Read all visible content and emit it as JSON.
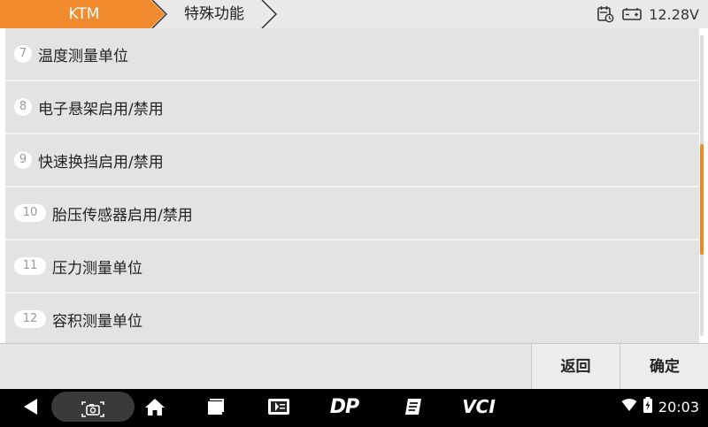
{
  "header": {
    "brand": "KTM",
    "section": "特殊功能",
    "battery_voltage": "12.28V",
    "accent_color": "#f28a2e",
    "icons": [
      "calendar-clock-icon",
      "battery-icon"
    ]
  },
  "list": {
    "items": [
      {
        "index": "7",
        "label": "温度测量单位"
      },
      {
        "index": "8",
        "label": "电子悬架启用/禁用"
      },
      {
        "index": "9",
        "label": "快速换挡启用/禁用"
      },
      {
        "index": "10",
        "label": "胎压传感器启用/禁用"
      },
      {
        "index": "11",
        "label": "压力测量单位"
      },
      {
        "index": "12",
        "label": "容积测量单位"
      }
    ]
  },
  "footer": {
    "back_label": "返回",
    "confirm_label": "确定"
  },
  "system_bar": {
    "time": "20:03",
    "icons": [
      "back-icon",
      "screenshot-icon",
      "home-icon",
      "recent-apps-icon",
      "app-icon",
      "dp-icon",
      "notes-icon",
      "vci-icon",
      "wifi-icon",
      "battery-icon"
    ],
    "dp_text": "DP",
    "vci_text": "VCI"
  }
}
